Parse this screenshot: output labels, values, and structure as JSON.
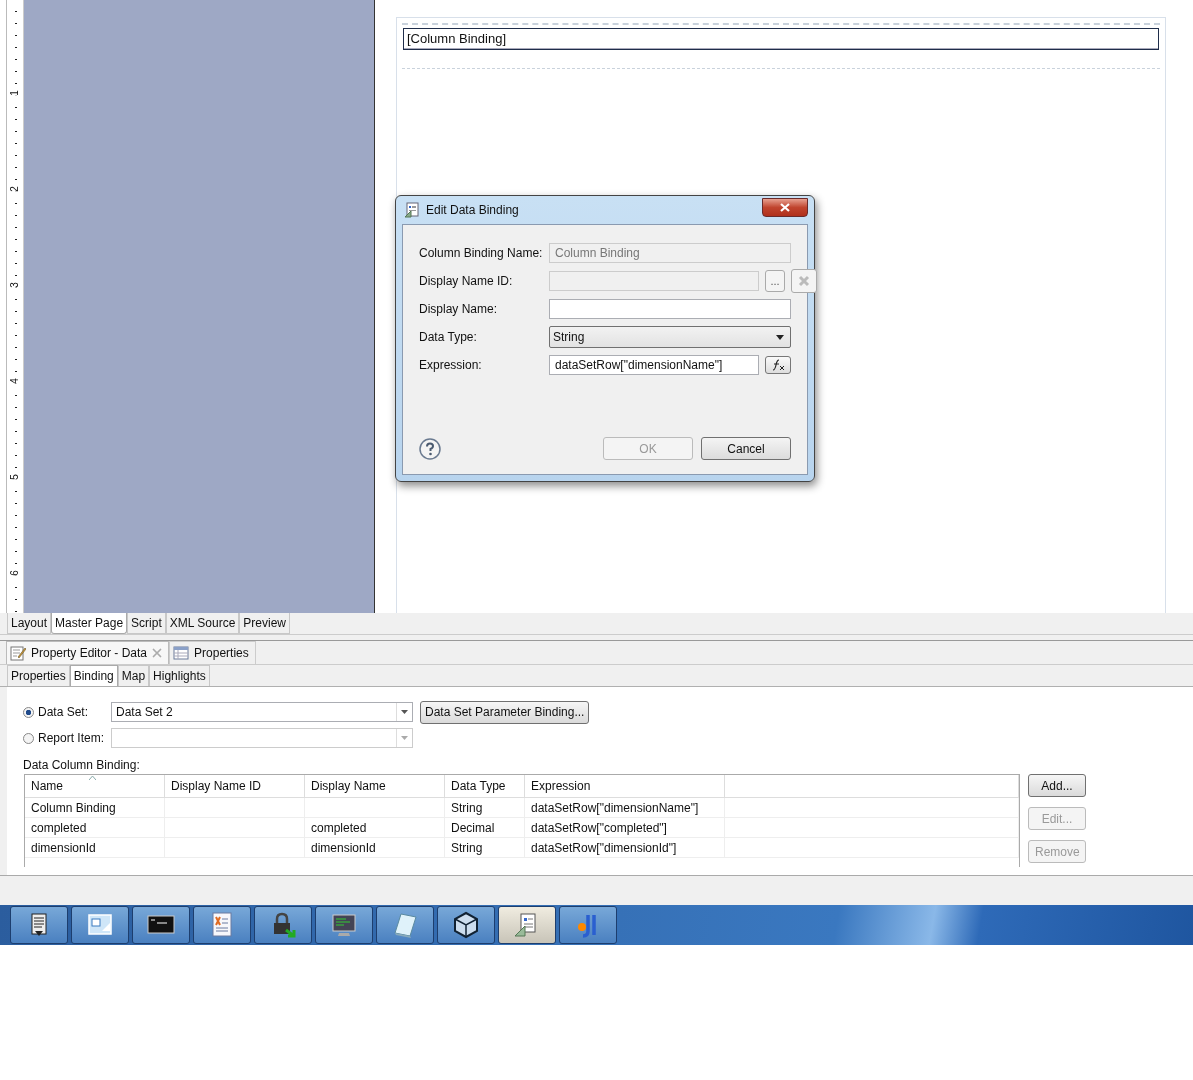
{
  "ruler": {
    "marks": [
      "1",
      "2",
      "3",
      "4",
      "5",
      "6"
    ]
  },
  "report_canvas": {
    "data_item": "[Column Binding]"
  },
  "dialog": {
    "title": "Edit Data Binding",
    "fields": [
      {
        "kind": "text",
        "label": "Column Binding Name:",
        "value": "Column Binding",
        "disabled": true
      },
      {
        "kind": "text-buttons",
        "label": "Display Name ID:",
        "disabled": true,
        "button": "..."
      },
      {
        "kind": "text",
        "label": "Display Name:",
        "disabled": false
      },
      {
        "kind": "select",
        "label": "Data Type:",
        "value": "String"
      },
      {
        "kind": "expression",
        "label": "Expression:",
        "value": "dataSetRow[\"dimensionName\"]"
      }
    ],
    "buttons": [
      {
        "label": "OK",
        "disabled": true
      },
      {
        "label": "Cancel",
        "disabled": false
      }
    ]
  },
  "editor_tabs": [
    {
      "label": "Layout",
      "selected": false
    },
    {
      "label": "Master Page",
      "selected": true
    },
    {
      "label": "Script",
      "selected": false
    },
    {
      "label": "XML Source",
      "selected": false
    },
    {
      "label": "Preview",
      "selected": false
    }
  ],
  "view_tabs": [
    {
      "label": "Property Editor - Data",
      "selected": true,
      "kind": "editor"
    },
    {
      "label": "Properties",
      "selected": false,
      "kind": "properties"
    }
  ],
  "sub_tabs": [
    {
      "label": "Properties",
      "selected": false
    },
    {
      "label": "Binding",
      "selected": true
    },
    {
      "label": "Map",
      "selected": false
    },
    {
      "label": "Highlights",
      "selected": false
    }
  ],
  "binding": {
    "sources": [
      {
        "label": "Data Set:",
        "selected": true,
        "value": "Data Set 2",
        "disabled": false
      },
      {
        "label": "Report Item:",
        "selected": false,
        "disabled": true
      }
    ],
    "parameter_button": "Data Set Parameter Binding...",
    "table_label": "Data Column Binding:",
    "table": {
      "columns": [
        "Name",
        "Display Name ID",
        "Display Name",
        "Data Type",
        "Expression"
      ],
      "rows": [
        [
          "Column Binding",
          "",
          "",
          "String",
          "dataSetRow[\"dimensionName\"]"
        ],
        [
          "completed",
          "",
          "completed",
          "Decimal",
          "dataSetRow[\"completed\"]"
        ],
        [
          "dimensionId",
          "",
          "dimensionId",
          "String",
          "dataSetRow[\"dimensionId\"]"
        ]
      ]
    },
    "buttons": [
      {
        "label": "Add...",
        "disabled": false
      },
      {
        "label": "Edit...",
        "disabled": true
      },
      {
        "label": "Remove",
        "disabled": true
      }
    ]
  },
  "taskbar": [
    {
      "kind": "document",
      "selected": false
    },
    {
      "kind": "window",
      "selected": false
    },
    {
      "kind": "terminal",
      "selected": false
    },
    {
      "kind": "text-document",
      "selected": false
    },
    {
      "kind": "lock",
      "selected": false
    },
    {
      "kind": "monitor",
      "selected": false
    },
    {
      "kind": "notepad",
      "selected": false
    },
    {
      "kind": "cube",
      "selected": false
    },
    {
      "kind": "report",
      "selected": true
    },
    {
      "kind": "app",
      "selected": false
    }
  ]
}
